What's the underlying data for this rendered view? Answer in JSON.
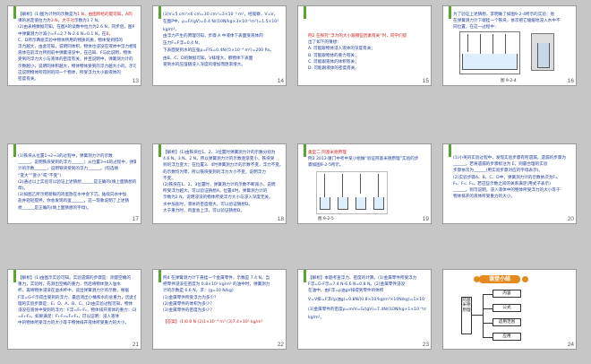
{
  "slides": [
    {
      "num": "13",
      "lines": [
        [
          "【解析】(1)图为计时的示数是为",
          "1 N，由图所给的量可知，A的"
        ],
        [
          "课的总定值拉力为",
          "3 N，大于对",
          "示数为1.7 N。"
        ],
        [
          "(2)由表格数据可知，在图A的读数中拉力为2.6 N，同步后，图P"
        ],
        [
          "中弹簧测力计减小=F=2.7 N-2.6 N=0.1 N，在",
          "B，"
        ],
        [
          "C、D所示两组实验中物体所用的物质的质，物体受到得的"
        ],
        [
          "浮力越大，由此可知，说明同体积，物体也浸没在液体中浮力相等"
        ],
        [
          "液体在前浮力所到前中弹簧浸没中，在已知、F与此说明，物体"
        ],
        [
          "受到的浮力大小与液体的密度有关，并且说明中，弹簧测力计的"
        ],
        [
          "示数越小，说明同体积越大，物体物体受到的浮力越大小的。示可知，"
        ],
        [
          "这说明物体所得到的同一个物体，所受浮力大小跟液体的"
        ],
        [
          "密度有关。"
        ]
      ]
    },
    {
      "num": "14",
      "lines": [
        [
          "(3)V=5 cm³×6 cm=30 cm³=3×10⁻⁵ m³，经观察，V=V，"
        ],
        [
          "在图P中，ρ=F/(gV)=0.4 N/(10N/kg×3×10⁻⁵m³)=1.5×10³"
        ],
        [
          "kg/m³。"
        ],
        [
          "由浮力产生的原理可知，步骤 A 中液体下表面受液体的"
        ],
        [
          "压力F=F浮=0.4 N，"
        ],
        [
          "下表面受到水的压强ρ=F/S=0.4N/(5×10⁻⁴ m²)=200 Pa。"
        ],
        [
          "由B、C、D的数据可知，V排增大，那物体下表面"
        ],
        [
          "受到水的压强随浸入深度的增加而逐渐增大。"
        ]
      ]
    },
    {
      "num": "15",
      "lines": [
        [
          "例2  在探究“浮力的大小跟哪些因素有关”时，同学们提"
        ],
        [
          "出了如下的猜想："
        ],
        [
          "A. 可能跟物体浸入液体的深度有关；"
        ],
        [
          "B. 可能跟物体的重力有关；"
        ],
        [
          "C. 可能跟液体的体积有关；"
        ],
        [
          "D. 可能跟液体的密度有关。"
        ]
      ]
    },
    {
      "num": "16",
      "lines": [
        [
          "为了验证上述猜想，李明做了如图9-2-4所示的实验：他"
        ],
        [
          "在弹簧测力计下端挂一个铁块，依次把它缓缓地浸入水中不"
        ],
        [
          "同位置，在这一过程中："
        ]
      ],
      "caption": "图 9-2-4"
    },
    {
      "num": "17",
      "lines": [
        [
          "(1)铁块从位置1→2→3的过程中，弹簧测力计的示数"
        ],
        [
          "______，说明铁块受到的浮力______；从位置3→4的过程中，弹簧测力"
        ],
        [
          "计的示数______，说明铁块受到的浮力______。(均选填"
        ],
        [
          "“变大”“变小”或“不变”)"
        ],
        [
          "(2)通过以上实验可以验证上述猜想______是正确的(填上面猜想的字"
        ],
        [
          "母)。"
        ],
        [
          "(3)如图乙所示把新鲜的鸡蛋放在水中会下沉，陆续向水中加"
        ],
        [
          "盐并轻轻搅拌，你会发现鸡蛋______，这一现象说明了上述猜"
        ],
        [
          "想______是正确的(填上面猜想的字母)。"
        ]
      ]
    },
    {
      "num": "18",
      "lines": [
        [
          "【解析】(1)由铁块位1、2、3位置时弹簧测力计的示数分别为"
        ],
        [
          "4.6 N、3 N、2 N，所以弹簧测力计的示数逐渐变小，铁块受"
        ],
        [
          "到的浮力变大；在位置3、4时弹簧测力计的示数不变，浮力不变。"
        ],
        [
          "的示数均为零，所以铁块受到的浮力大小不变，说明浮力"
        ],
        [
          "不变。"
        ],
        [
          "(2)铁块在1、2、3位置时，弹簧测力计的示数不断减小，说明"
        ],
        [
          "所受浮力越大，可以验证猜想A，位置4时，弹簧测力计的"
        ],
        [
          "示数为2 N，说明浸没的物体所受浮力大小与浸入深度无关。"
        ],
        [
          "水中加盐时，液体的密度增大，可以验证猜想D。"
        ],
        [
          "大于重力时，鸡蛋会上浮，可以验证猜想D。"
        ]
      ]
    },
    {
      "num": "19",
      "lines": [
        [
          "类型二  阿基米德原理"
        ],
        [
          "例3  2013·厦门中考中某小组做“验证阿基米德原理”实验的步"
        ],
        [
          "骤如图9-2-5所示。"
        ]
      ],
      "caption": "图 9-2-5"
    },
    {
      "num": "20",
      "lines": [
        [
          "(1)小英的实验过程中，发现实验步骤有所遗漏，遗漏的步骤为"
        ],
        [
          "______，若将遗漏的步骤标注为 E，则最合理的实验"
        ],
        [
          "步骤依次为______(用实验步骤对应的字母表示)。"
        ],
        [
          "(2)实验步骤A、B、C、D中，弹簧测力计的示数依次为F₁、"
        ],
        [
          "F₂、F₃、F₄。若这些示数之间的关系满足(用式子表示)"
        ],
        [
          "______，则可说明，浸入液体中的物体所受浮力的大小等于"
        ],
        [
          "物体排开的液体所受重力的大小。"
        ]
      ]
    },
    {
      "num": "21",
      "lines": [
        [
          "【解析】(1)由图示实验可知，实验遗漏的步骤是：测量空桶的"
        ],
        [
          "重力，实验时，先测出空桶的重力，然后将物体放入溢水"
        ],
        [
          "杯，再将物体浸没在溢水杯中，读出弹簧测力计的示数，根据"
        ],
        [
          "F浮=G-F示得出受到的浮力，最后测出小桶和水的总重力，因此合"
        ],
        [
          "理的实验步骤是：E、D、A、B、C。(2)由实验过程可知，物体"
        ],
        [
          "浸没在液体中受到的浮力：F浮=F₁-F₂，物体排开液体的重力：G排"
        ],
        [
          "=F₃-F₄，如果满足：F₁-F₂=F₃-F₄，可以证明：浸入液体"
        ],
        [
          "中的物体所受浮力的大小等于物体排开液体所受重力的大小。"
        ]
      ]
    },
    {
      "num": "22",
      "lines": [
        [
          "例4  在弹簧测力计下悬挂一个金属零件，示数是 7.4 N。当"
        ],
        [
          "把零件浸没在密度为 0.8×10³ kg/m³ 的油中时，弹簧测力"
        ],
        [
          "计的示数是 6.6 N，求：(g=10 N/kg)"
        ],
        [
          "(1)金属零件所受浮力为多少？"
        ],
        [
          "(2)金属零件的体积为多少？"
        ],
        [
          "(3)金属零件的密度为多少？"
        ],
        [
          "【答案】(1)0.8 N  (2)1×10⁻⁴ m³  (3)7.4×10³ kg/m³"
        ]
      ]
    },
    {
      "num": "23",
      "lines": [
        [
          "【解析】本题考查浮力、密度的计算。(1)金属零件所受浮力"
        ],
        [
          "F浮=G-F示=7.4 N-6.6 N=0.8 N。(2)金属零件浸没"
        ],
        [
          "在油中，由F浮=ρ油gV排得到零件的体积"
        ],
        [
          "V=V排=F浮/(ρ油g)=0.8N/(0.8×10³kg/m³×10N/kg)=1×10⁻⁴ m³。"
        ],
        [
          "(3)金属零件的密度ρ=m/V=G/(gV)=7.4N/(10N/kg×1×10⁻⁴m³)=7.4×10³"
        ],
        [
          "kg/m³。"
        ]
      ]
    },
    {
      "num": "24",
      "title": "课堂小结",
      "root": "阿基米德原理",
      "nodes": [
        "内容",
        "公式",
        "适用范围",
        "应用"
      ]
    }
  ]
}
